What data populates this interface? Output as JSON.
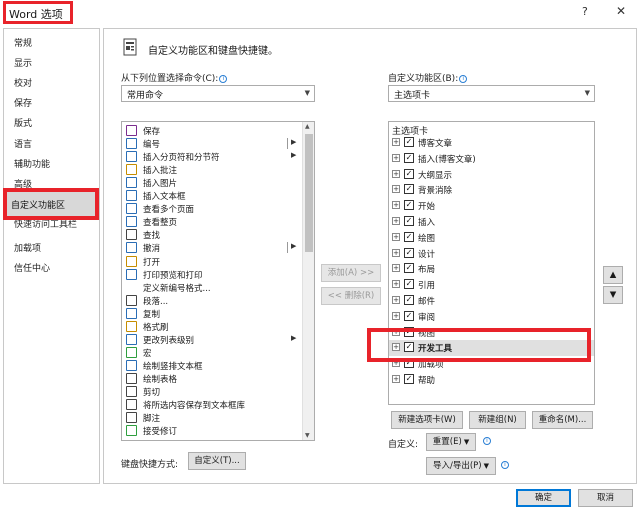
{
  "window": {
    "title": "Word 选项",
    "help": "?",
    "close": "✕"
  },
  "sidebar": {
    "items": [
      "常规",
      "显示",
      "校对",
      "保存",
      "版式",
      "语言",
      "辅助功能",
      "高级"
    ],
    "selected": "自定义功能区",
    "after": [
      "快速访问工具栏",
      "加载项",
      "信任中心"
    ]
  },
  "header": {
    "title": "自定义功能区和键盘快捷键。"
  },
  "left": {
    "choose_label": "从下列位置选择命令(C):",
    "choose_value": "常用命令",
    "commands": [
      {
        "label": "保存",
        "icon": "save-icon"
      },
      {
        "label": "编号",
        "icon": "numbering-icon",
        "split": true
      },
      {
        "label": "插入分页符和分节符",
        "icon": "page-break-icon",
        "submenu": true
      },
      {
        "label": "插入批注",
        "icon": "comment-icon"
      },
      {
        "label": "插入图片",
        "icon": "picture-icon"
      },
      {
        "label": "插入文本框",
        "icon": "textbox-icon"
      },
      {
        "label": "查看多个页面",
        "icon": "multi-page-icon"
      },
      {
        "label": "查看整页",
        "icon": "one-page-icon"
      },
      {
        "label": "查找",
        "icon": "find-icon"
      },
      {
        "label": "撤消",
        "icon": "undo-icon",
        "split": true
      },
      {
        "label": "打开",
        "icon": "open-icon"
      },
      {
        "label": "打印预览和打印",
        "icon": "print-preview-icon"
      },
      {
        "label": "定义新编号格式...",
        "icon": "none"
      },
      {
        "label": "段落...",
        "icon": "paragraph-icon"
      },
      {
        "label": "复制",
        "icon": "copy-icon"
      },
      {
        "label": "格式刷",
        "icon": "format-painter-icon"
      },
      {
        "label": "更改列表级别",
        "icon": "list-level-icon",
        "submenu": true
      },
      {
        "label": "宏",
        "icon": "macro-icon"
      },
      {
        "label": "绘制竖排文本框",
        "icon": "vertical-textbox-icon"
      },
      {
        "label": "绘制表格",
        "icon": "draw-table-icon"
      },
      {
        "label": "剪切",
        "icon": "cut-icon"
      },
      {
        "label": "将所选内容保存到文本框库",
        "icon": "save-selection-icon"
      },
      {
        "label": "脚注",
        "icon": "footnote-icon"
      },
      {
        "label": "接受修订",
        "icon": "accept-icon"
      }
    ],
    "shortcut_label": "键盘快捷方式:",
    "shortcut_button": "自定义(T)..."
  },
  "middle": {
    "add_button": "添加(A) >>",
    "remove_button": "<< 删除(R)"
  },
  "right": {
    "ribbon_label": "自定义功能区(B):",
    "ribbon_value": "主选项卡",
    "tree_header": "主选项卡",
    "tabs": [
      {
        "label": "博客文章",
        "checked": true
      },
      {
        "label": "插入(博客文章)",
        "checked": true
      },
      {
        "label": "大纲显示",
        "checked": true
      },
      {
        "label": "背景消除",
        "checked": true
      },
      {
        "label": "开始",
        "checked": true
      },
      {
        "label": "插入",
        "checked": true
      },
      {
        "label": "绘图",
        "checked": true
      },
      {
        "label": "设计",
        "checked": true
      },
      {
        "label": "布局",
        "checked": true
      },
      {
        "label": "引用",
        "checked": true
      },
      {
        "label": "邮件",
        "checked": true
      },
      {
        "label": "审阅",
        "checked": true
      },
      {
        "label": "视图",
        "checked": true
      },
      {
        "label": "开发工具",
        "checked": true,
        "selected": true
      },
      {
        "label": "加载项",
        "checked": true
      },
      {
        "label": "帮助",
        "checked": true
      }
    ],
    "new_tab_button": "新建选项卡(W)",
    "new_group_button": "新建组(N)",
    "rename_button": "重命名(M)...",
    "customize_label": "自定义:",
    "reset_button": "重置(E)",
    "import_export_button": "导入/导出(P)",
    "move_up": "▲",
    "move_down": "▼"
  },
  "footer": {
    "ok_button": "确定",
    "cancel_button": "取消"
  }
}
